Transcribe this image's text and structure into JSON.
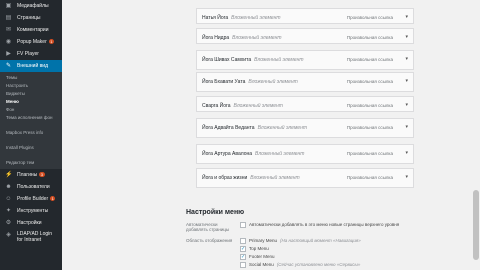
{
  "sidebar": {
    "items_top": [
      {
        "label": "Медиафайлы",
        "icon": "media-icon"
      },
      {
        "label": "Страницы",
        "icon": "page-icon"
      },
      {
        "label": "Комментарии",
        "icon": "comment-icon"
      },
      {
        "label": "Popup Maker",
        "icon": "popup-icon",
        "badge": "1"
      },
      {
        "label": "FV Player",
        "icon": "player-icon"
      }
    ],
    "active": {
      "label": "Внешний вид",
      "icon": "brush-icon"
    },
    "submenu": [
      "Темы",
      "Настроить",
      "Виджеты",
      "Меню",
      "Фон",
      "Тема исполнения фон",
      "Mapbox Press info",
      "Install Plugins",
      "Редактор тем"
    ],
    "submenu_current": "Меню",
    "items_bottom": [
      {
        "label": "Плагины",
        "icon": "plugin-icon",
        "badge": "3"
      },
      {
        "label": "Пользователи",
        "icon": "users-icon"
      },
      {
        "label": "Profile Builder",
        "icon": "profile-icon",
        "badge": "1"
      },
      {
        "label": "Инструменты",
        "icon": "tools-icon"
      },
      {
        "label": "Настройки",
        "icon": "settings-icon"
      },
      {
        "label": "LDAP/AD Login for Intranet",
        "icon": "login-icon"
      }
    ]
  },
  "menu_items": [
    {
      "name": "Натья Йога",
      "sub": "Вложенный элемент",
      "type": "Произвольная ссылка"
    },
    {
      "name": "Йога Нидра",
      "sub": "Вложенный элемент",
      "type": "Произвольная ссылка"
    },
    {
      "name": "Йога Шивах Самхита",
      "sub": "Вложенный элемент",
      "type": "Произвольная ссылка"
    },
    {
      "name": "Йога Бхавати Уата",
      "sub": "Вложенный элемент",
      "type": "Произвольная ссылка"
    },
    {
      "name": "Сварга Йога",
      "sub": "Вложенный элемент",
      "type": "Произвольная ссылка"
    },
    {
      "name": "Йога Адвайта Веданта",
      "sub": "Вложенный элемент",
      "type": "Произвольная ссылка"
    },
    {
      "name": "Йога Артура Авалона",
      "sub": "Вложенный элемент",
      "type": "Произвольная ссылка"
    },
    {
      "name": "Йога и образ жизни",
      "sub": "Вложенный элемент",
      "type": "Произвольная ссылка"
    }
  ],
  "settings": {
    "title": "Настройки меню",
    "auto_add_label": "Автоматически добавлять страницы",
    "auto_add_option": "Автоматически добавлять в это меню новые страницы верхнего уровня",
    "location_label": "Область отображения",
    "locations": [
      {
        "label": "Primary Menu",
        "note": "(На настоящий момент «Навигация»",
        "checked": false
      },
      {
        "label": "Top Menu",
        "note": "",
        "checked": true
      },
      {
        "label": "Footer Menu",
        "note": "",
        "checked": true
      },
      {
        "label": "Social Menu",
        "note": "(Сейчас установлено меню «Сервисы»",
        "checked": false
      }
    ]
  }
}
